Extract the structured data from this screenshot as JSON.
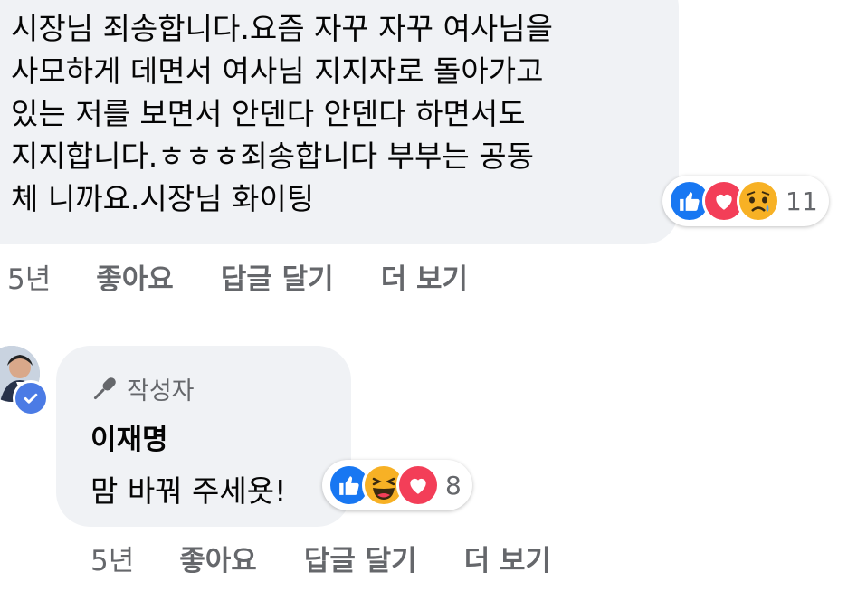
{
  "comment1": {
    "lines": [
      "시장님 죄송합니다.요즘 자꾸 자꾸 여사님을",
      "사모하게 데면서 여사님 지지자로 돌아가고",
      "있는 저를 보면서 안덴다 안덴다 하면서도",
      "지지합니다.ㅎㅎㅎ죄송합니다 부부는 공동",
      "체 니까요.시장님 화이팅"
    ],
    "reactions": [
      "like-icon",
      "love-icon",
      "sad-icon"
    ],
    "reaction_count": "11",
    "time": "5년",
    "like_label": "좋아요",
    "reply_label": "답글 달기",
    "more_label": "더 보기"
  },
  "comment2": {
    "badge": "작성자",
    "author": "이재명",
    "text": "맘 바꿔 주세욧!",
    "reactions": [
      "like-icon",
      "haha-icon",
      "love-icon"
    ],
    "reaction_count": "8",
    "time": "5년",
    "like_label": "좋아요",
    "reply_label": "답글 달기",
    "more_label": "더 보기"
  },
  "colors": {
    "bubble": "#f0f2f5",
    "meta_text": "#65676b",
    "like": "#1877f2",
    "love": "#f33e58",
    "haha": "#f7b125"
  }
}
